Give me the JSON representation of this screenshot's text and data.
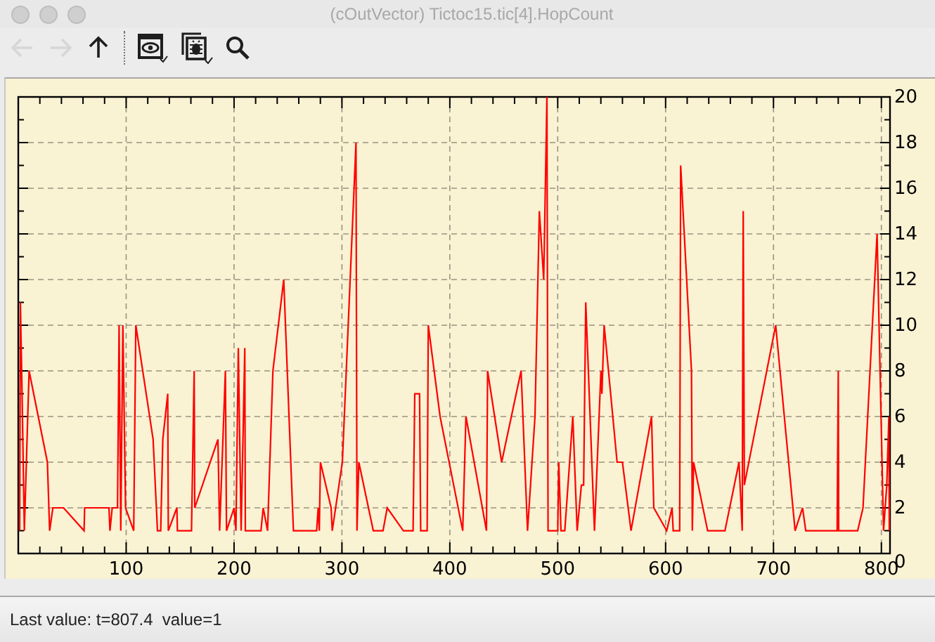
{
  "window": {
    "title": "(cOutVector) Tictoc15.tic[4].HopCount"
  },
  "toolbar": [
    {
      "kind": "back",
      "disabled": true
    },
    {
      "kind": "forward",
      "disabled": true
    },
    {
      "kind": "up",
      "disabled": false
    },
    {
      "kind": "separator"
    },
    {
      "kind": "view",
      "disabled": false
    },
    {
      "kind": "inspect",
      "disabled": false
    },
    {
      "kind": "find",
      "disabled": false
    }
  ],
  "chart": {
    "chart_data": {
      "type": "line",
      "grid": true,
      "xlim": [
        0,
        808
      ],
      "ylim": [
        0,
        20
      ],
      "xticks": [
        100,
        200,
        300,
        400,
        500,
        600,
        700,
        800
      ],
      "yticks": [
        0,
        2,
        4,
        6,
        8,
        10,
        12,
        14,
        16,
        18,
        20
      ],
      "x": [
        1.3,
        2,
        3.5,
        5.6,
        10,
        27,
        29,
        32,
        42,
        61,
        61.5,
        84,
        85,
        87,
        92,
        93.5,
        95,
        97,
        99.5,
        107,
        109,
        125,
        129,
        132,
        134,
        138.5,
        139,
        147,
        147.5,
        160.6,
        163,
        163.5,
        185,
        186.6,
        192,
        193,
        200,
        201.7,
        204,
        206.5,
        210,
        210.5,
        225,
        227,
        231,
        236,
        246,
        255,
        276.6,
        278,
        279,
        280,
        290,
        291,
        300.4,
        313,
        314,
        315.6,
        329,
        338,
        342,
        357,
        366,
        367.5,
        372,
        373,
        379,
        380,
        391,
        412,
        415,
        434,
        435,
        448,
        466,
        472,
        479,
        483,
        487,
        490,
        491,
        500,
        501,
        503,
        506.5,
        514,
        518,
        522,
        524,
        526,
        534,
        540,
        541,
        543,
        555,
        560,
        568,
        587,
        589,
        601,
        606,
        607,
        613,
        614,
        624,
        624.8,
        626,
        639,
        655,
        668,
        671,
        672,
        673,
        702,
        720,
        727,
        730,
        759,
        760,
        760.4,
        778,
        783,
        796,
        802,
        805,
        807,
        807.4
      ],
      "series": [
        {
          "color": "#ff0000",
          "values": [
            1,
            11,
            7,
            1,
            8,
            4,
            1,
            2,
            2,
            1,
            2,
            2,
            1,
            2,
            2,
            10,
            1,
            10,
            2,
            1,
            10,
            5,
            1,
            1,
            5,
            7,
            1,
            2,
            1,
            1,
            8,
            2,
            5,
            1,
            8,
            1,
            2,
            1,
            9,
            1,
            9,
            1,
            1,
            2,
            1,
            8,
            12,
            1,
            1,
            2,
            1,
            4,
            2,
            1,
            4,
            18,
            1,
            4,
            1,
            1,
            2,
            1,
            1,
            7,
            7,
            1,
            1,
            10,
            6,
            1,
            6,
            1,
            8,
            4,
            8,
            1,
            6,
            15,
            12,
            20,
            1,
            1,
            4,
            1,
            1,
            6,
            1,
            3,
            3,
            11,
            1,
            8,
            7,
            10,
            4,
            4,
            1,
            6,
            2,
            1,
            2,
            1,
            1,
            17,
            8,
            1,
            4,
            1,
            1,
            4,
            1,
            15,
            3,
            10,
            1,
            2,
            1,
            1,
            8,
            1,
            1,
            2,
            14,
            1,
            3,
            6,
            1
          ]
        }
      ]
    }
  },
  "status_bar": {
    "text": "Last value: t=807.4  value=1"
  }
}
